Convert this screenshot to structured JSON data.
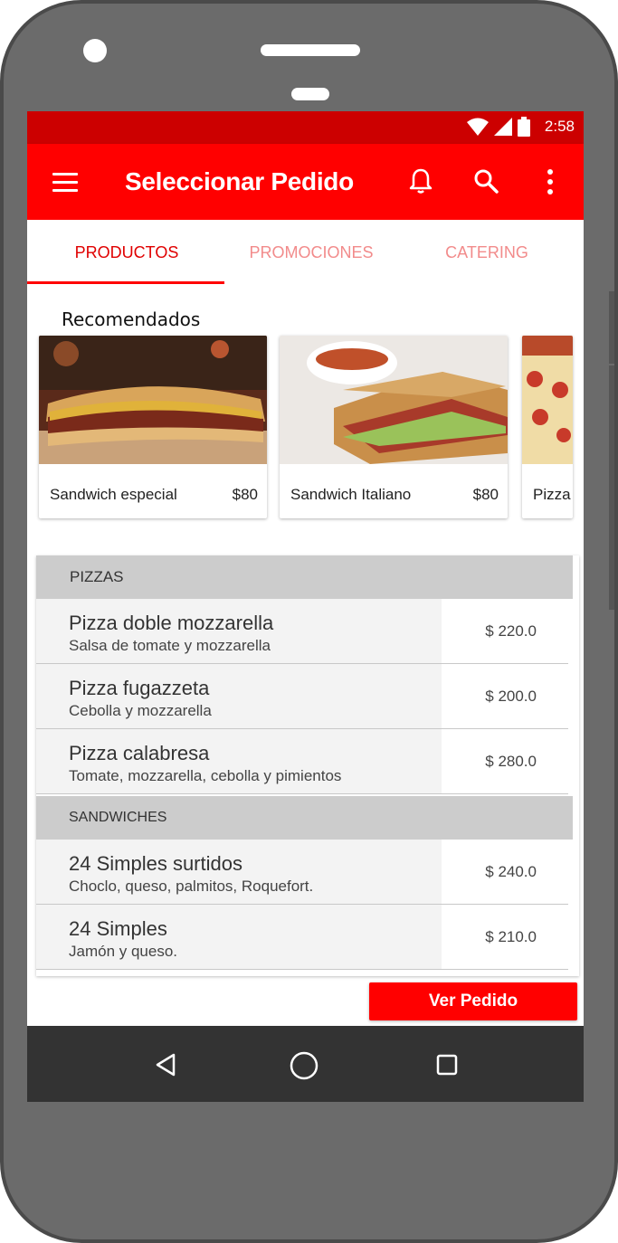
{
  "statusbar": {
    "time": "2:58"
  },
  "appbar": {
    "title": "Seleccionar Pedido"
  },
  "tabs": [
    {
      "label": "PRODUCTOS",
      "active": true
    },
    {
      "label": "PROMOCIONES",
      "active": false
    },
    {
      "label": "CATERING",
      "active": false
    }
  ],
  "recommended": {
    "title": "Recomendados",
    "cards": [
      {
        "name": "Sandwich especial",
        "price": "$80"
      },
      {
        "name": "Sandwich Italiano",
        "price": "$80"
      },
      {
        "name": "Pizza",
        "price": ""
      }
    ]
  },
  "menu": {
    "sections": [
      {
        "title": "PIZZAS",
        "items": [
          {
            "name": "Pizza doble mozzarella",
            "desc": "Salsa de tomate y mozzarella",
            "price": "$ 220.0"
          },
          {
            "name": "Pizza fugazzeta",
            "desc": "Cebolla y  mozzarella",
            "price": "$ 200.0"
          },
          {
            "name": "Pizza calabresa",
            "desc": "Tomate, mozzarella, cebolla y pimientos",
            "price": "$ 280.0"
          }
        ]
      },
      {
        "title": "SANDWICHES",
        "items": [
          {
            "name": "24 Simples surtidos",
            "desc": "Choclo, queso, palmitos, Roquefort.",
            "price": "$ 240.0"
          },
          {
            "name": "24 Simples",
            "desc": "Jamón y queso.",
            "price": "$ 210.0"
          }
        ]
      }
    ]
  },
  "actions": {
    "ver_pedido": "Ver Pedido"
  },
  "colors": {
    "primary": "#ff0000",
    "primary_dark": "#cc0000",
    "tab_inactive": "#f28b8b",
    "section_header": "#cccccc",
    "navbar": "#333333"
  },
  "icons": [
    "menu-icon",
    "bell-icon",
    "search-icon",
    "more-vert-icon",
    "wifi-icon",
    "signal-icon",
    "battery-icon",
    "back-icon",
    "home-icon",
    "recent-apps-icon"
  ]
}
